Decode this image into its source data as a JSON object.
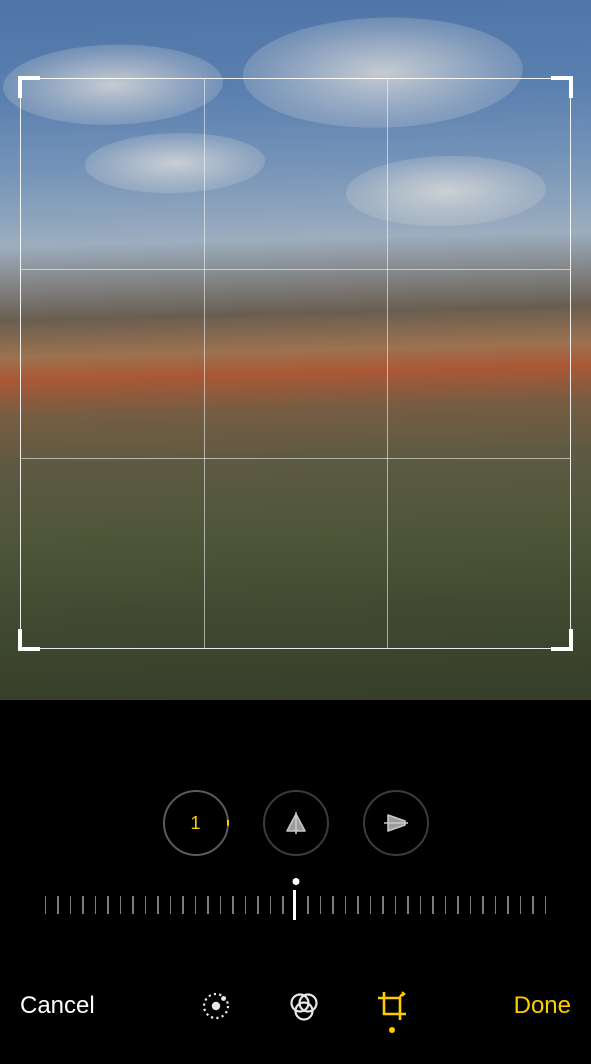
{
  "editor": {
    "rotation_value": "1",
    "slider_ticks": 41,
    "slider_position": 0.5
  },
  "tools": {
    "straighten_selected": true
  },
  "bottombar": {
    "cancel_label": "Cancel",
    "done_label": "Done",
    "active_mode": "crop"
  },
  "colors": {
    "accent": "#ffcc00"
  }
}
